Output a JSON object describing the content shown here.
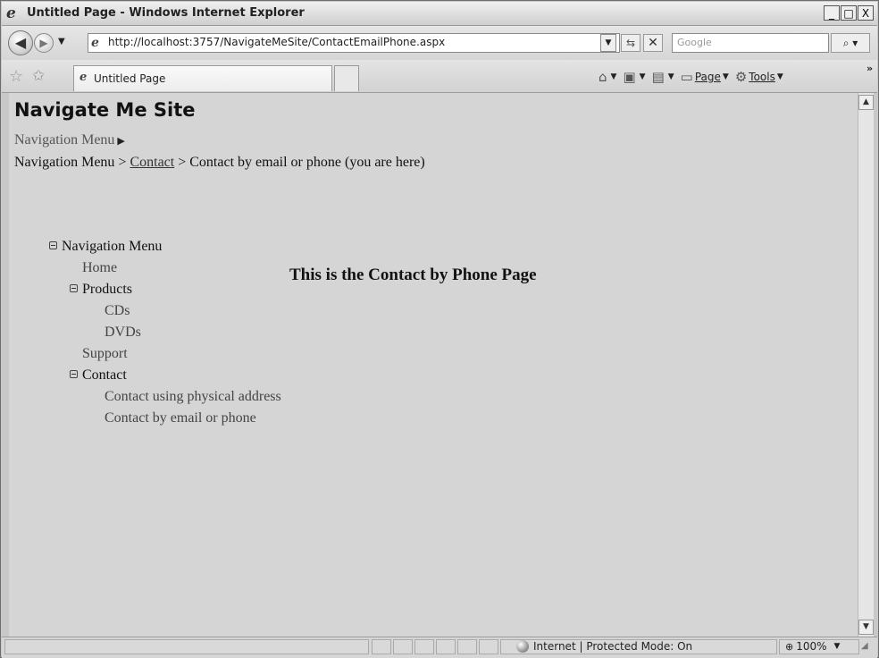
{
  "window": {
    "title": "Untitled Page - Windows Internet Explorer",
    "minimize": "_",
    "maximize": "□",
    "close": "X"
  },
  "toolbar": {
    "address": "http://localhost:3757/NavigateMeSite/ContactEmailPhone.aspx",
    "search_placeholder": "Google",
    "search_icon": "search-icon"
  },
  "favorites_bar": {
    "tab_label": "Untitled Page"
  },
  "command_bar": {
    "page_label": "Page",
    "tools_label": "Tools",
    "icons": [
      "home-icon",
      "feeds-icon",
      "print-icon",
      "page-icon",
      "tools-gear-icon"
    ]
  },
  "page": {
    "site_title": "Navigate Me Site",
    "menu_label": "Navigation Menu",
    "breadcrumb": {
      "root": "Navigation Menu",
      "sep1": " > ",
      "link": "Contact",
      "sep2": " > ",
      "current": "Contact by email or phone (you are here)"
    },
    "tree": {
      "root": "Navigation Menu",
      "home": "Home",
      "products": "Products",
      "cds": "CDs",
      "dvds": "DVDs",
      "support": "Support",
      "contact": "Contact",
      "physical": "Contact using physical address",
      "email": "Contact by email or phone"
    },
    "message": "This is the Contact by Phone Page"
  },
  "statusbar": {
    "zone": "Internet | Protected Mode: On",
    "zoom": "100%"
  }
}
